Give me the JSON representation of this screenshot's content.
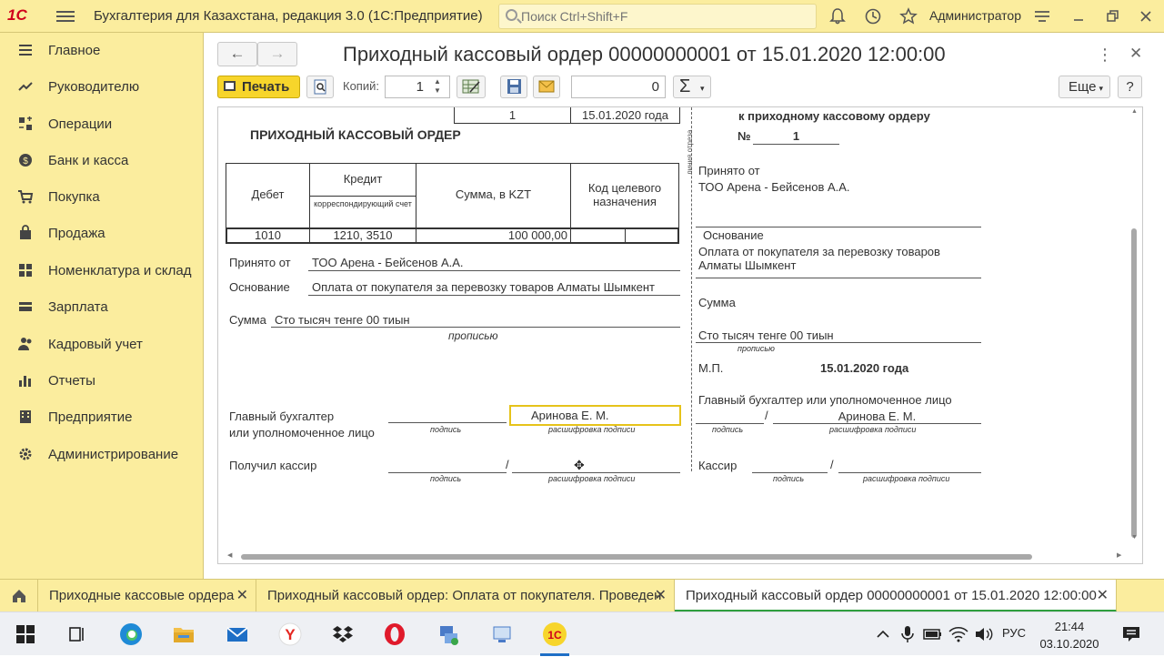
{
  "header": {
    "logo": "1С",
    "app_title": "Бухгалтерия для Казахстана, редакция 3.0  (1С:Предприятие)",
    "search_placeholder": "Поиск Ctrl+Shift+F",
    "user": "Администратор"
  },
  "sidebar": {
    "items": [
      {
        "label": "Главное",
        "icon": "menu-lines-icon"
      },
      {
        "label": "Руководителю",
        "icon": "trend-chart-icon"
      },
      {
        "label": "Операции",
        "icon": "operations-icon"
      },
      {
        "label": "Банк и касса",
        "icon": "bank-icon"
      },
      {
        "label": "Покупка",
        "icon": "cart-icon"
      },
      {
        "label": "Продажа",
        "icon": "bag-icon"
      },
      {
        "label": "Номенклатура и склад",
        "icon": "grid-icon"
      },
      {
        "label": "Зарплата",
        "icon": "salary-icon"
      },
      {
        "label": "Кадровый учет",
        "icon": "people-icon"
      },
      {
        "label": "Отчеты",
        "icon": "bar-chart-icon"
      },
      {
        "label": "Предприятие",
        "icon": "building-icon"
      },
      {
        "label": "Администрирование",
        "icon": "gear-icon"
      }
    ]
  },
  "window": {
    "title": "Приходный кассовый ордер 00000000001 от 15.01.2020 12:00:00",
    "print_label": "Печать",
    "copies_label": "Копий:",
    "copies_value": "1",
    "sum_value": "0",
    "more_label": "Еще",
    "help_label": "?"
  },
  "form": {
    "top_number": "1",
    "top_date": "15.01.2020 года",
    "heading": "ПРИХОДНЫЙ КАССОВЫЙ ОРДЕР",
    "table": {
      "debit_header": "Дебет",
      "credit_header": "Кредит",
      "credit_sub": "корреспондирующий счет",
      "amount_header": "Сумма, в KZT",
      "purpose_header": "Код целевого назначения",
      "debit_value": "1010",
      "credit_value": "1210, 3510",
      "amount_value": "100 000,00"
    },
    "received_from_label": "Принято от",
    "received_from": "ТОО Арена - Бейсенов А.А.",
    "basis_label": "Основание",
    "basis": "Оплата от покупателя за перевозку товаров Алматы Шымкент",
    "sum_label": "Сумма",
    "sum_words": "Сто тысяч тенге 00 тиын",
    "in_words": "прописью",
    "chief_label_1": "Главный бухгалтер",
    "chief_label_2": "или уполномоченное лицо",
    "chief_name": "Аринова Е. М.",
    "signature": "подпись",
    "signature_decode": "расшифровка подписи",
    "cashier_label": "Получил кассир"
  },
  "receipt": {
    "heading": "к приходному кассовому ордеру",
    "number_label": "№",
    "number": "1",
    "received_from_label": "Принято от",
    "received_from": "ТОО Арена - Бейсенов А.А.",
    "basis_label": "Основание",
    "basis_line1": "Оплата от покупателя за перевозку товаров",
    "basis_line2": "Алматы Шымкент",
    "sum_label": "Сумма",
    "sum_words": "Сто тысяч тенге 00 тиын",
    "in_words": "прописью",
    "stamp_label": "М.П.",
    "date": "15.01.2020 года",
    "chief_label": "Главный бухгалтер или уполномоченное лицо",
    "chief_name": "Аринова Е. М.",
    "cashier_label": "Кассир",
    "cut_line": "линия отреза"
  },
  "open_tabs": [
    {
      "label": "Приходные кассовые ордера"
    },
    {
      "label": "Приходный кассовый ордер: Оплата от покупателя. Проведен"
    },
    {
      "label": "Приходный кассовый ордер 00000000001 от 15.01.2020 12:00:00"
    }
  ],
  "taskbar": {
    "language": "РУС",
    "time": "21:44",
    "date": "03.10.2020"
  },
  "colors": {
    "panel_yellow": "#fbed9e",
    "print_button": "#f7d52b",
    "active_tab_underline": "#2e9e3e",
    "focus_border": "#e6c31a"
  }
}
